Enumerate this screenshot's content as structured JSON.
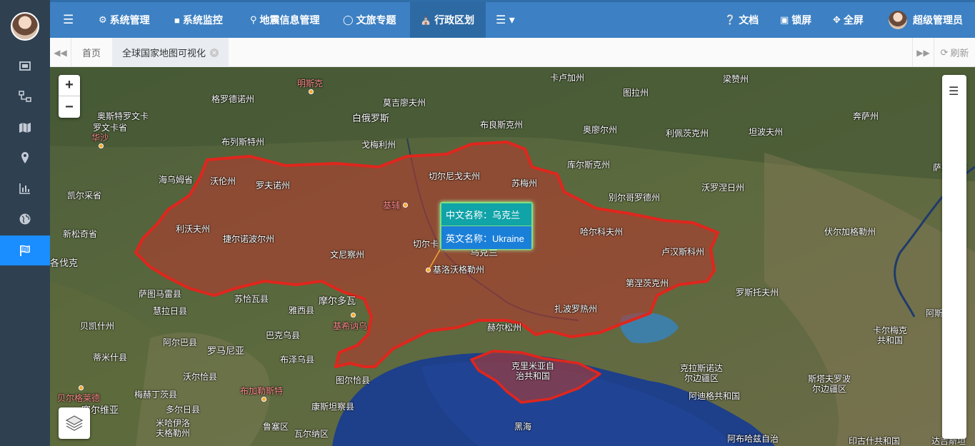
{
  "nav": {
    "items": [
      {
        "label": "系统管理",
        "icon": "gear-icon"
      },
      {
        "label": "系统监控",
        "icon": "video-icon"
      },
      {
        "label": "地震信息管理",
        "icon": "map-pin-icon"
      },
      {
        "label": "文旅专题",
        "icon": "globe-icon"
      },
      {
        "label": "行政区划",
        "icon": "bank-icon"
      }
    ],
    "more_icon": "list-dropdown-icon",
    "docs": "文档",
    "lock": "锁屏",
    "fullscreen": "全屏",
    "user": "超级管理员"
  },
  "tabs": {
    "home": "首页",
    "active": "全球国家地图可视化",
    "refresh": "刷新"
  },
  "popup": {
    "cn": "中文名称：乌克兰",
    "en": "英文名称：Ukraine"
  },
  "map_labels": [
    {
      "text": "卡卢加州"
    },
    {
      "text": "梁赞州"
    },
    {
      "text": "格罗德诺州"
    },
    {
      "text": "明斯克"
    },
    {
      "text": "莫吉廖夫州"
    },
    {
      "text": "图拉州"
    },
    {
      "text": "奥斯特罗文卡"
    },
    {
      "text": "白俄罗斯"
    },
    {
      "text": "布良斯克州"
    },
    {
      "text": "奔萨州"
    },
    {
      "text": "罗文卡省"
    },
    {
      "text": "华沙"
    },
    {
      "text": "奥廖尔州"
    },
    {
      "text": "利佩茨克州"
    },
    {
      "text": "坦波夫州"
    },
    {
      "text": "布列斯特州"
    },
    {
      "text": "戈梅利州"
    },
    {
      "text": "切尔尼戈夫州"
    },
    {
      "text": "库尔斯克州"
    },
    {
      "text": "萨拉托夫"
    },
    {
      "text": "海乌姆省"
    },
    {
      "text": "沃伦州"
    },
    {
      "text": "罗夫诺州"
    },
    {
      "text": "苏梅州"
    },
    {
      "text": "沃罗涅日州"
    },
    {
      "text": "凯尔采省"
    },
    {
      "text": "基辅"
    },
    {
      "text": "别尔哥罗德州"
    },
    {
      "text": "利沃夫州"
    },
    {
      "text": "新松奇省"
    },
    {
      "text": "哈尔科夫州"
    },
    {
      "text": "伏尔加格勒州"
    },
    {
      "text": "捷尔诺波尔州"
    },
    {
      "text": "切尔卡"
    },
    {
      "text": "乌克兰"
    },
    {
      "text": "卢汉斯科州"
    },
    {
      "text": "各伐克"
    },
    {
      "text": "文尼察州"
    },
    {
      "text": "基洛沃格勒州"
    },
    {
      "text": "萨图马雷县"
    },
    {
      "text": "苏恰瓦县"
    },
    {
      "text": "第涅茨克州"
    },
    {
      "text": "罗斯托夫州"
    },
    {
      "text": "摩尔多瓦"
    },
    {
      "text": "慧拉日县"
    },
    {
      "text": "雅西县"
    },
    {
      "text": "扎波罗热州"
    },
    {
      "text": "阿斯"
    },
    {
      "text": "贝凯什州"
    },
    {
      "text": "基希讷乌"
    },
    {
      "text": "巴克乌县"
    },
    {
      "text": "赫尔松州"
    },
    {
      "text": "卡尔梅克共和国"
    },
    {
      "text": "阿尔巴县"
    },
    {
      "text": "罗马尼亚"
    },
    {
      "text": "克里米亚自治共和国"
    },
    {
      "text": "蒂米什县"
    },
    {
      "text": "布泽乌县"
    },
    {
      "text": "图尔恰县"
    },
    {
      "text": "克拉斯诺达尔边疆区"
    },
    {
      "text": "斯塔夫罗波尔边疆区"
    },
    {
      "text": "沃尔恰县"
    },
    {
      "text": "贝尔格莱德"
    },
    {
      "text": "梅赫丁茨县"
    },
    {
      "text": "布加勒斯特"
    },
    {
      "text": "阿迪格共和国"
    },
    {
      "text": "康斯坦察县"
    },
    {
      "text": "塞尔维亚"
    },
    {
      "text": "多尔日县"
    },
    {
      "text": "米哈伊洛夫格勒州"
    },
    {
      "text": "鲁塞区"
    },
    {
      "text": "瓦尔纳区"
    },
    {
      "text": "黑海"
    },
    {
      "text": "阿布哈兹自治"
    },
    {
      "text": "印古什共和国"
    },
    {
      "text": "达吉斯坦"
    }
  ],
  "colors": {
    "sidebar": "#2f4050",
    "topbar": "#3d80c3",
    "active_side": "#1a8dff",
    "border_red": "#e0261d",
    "popup_top": "#10a3a8",
    "popup_bottom": "#1a7fd8"
  }
}
